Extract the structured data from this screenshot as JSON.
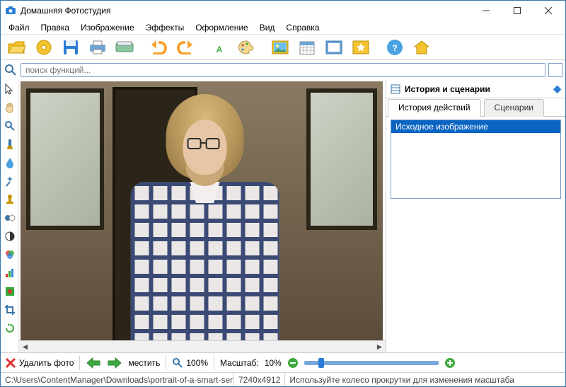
{
  "app_title": "Домашняя Фотостудия",
  "menu": [
    "Файл",
    "Правка",
    "Изображение",
    "Эффекты",
    "Оформление",
    "Вид",
    "Справка"
  ],
  "toolbar_icons": [
    "open",
    "cd",
    "save",
    "print",
    "scan",
    "undo",
    "redo",
    "text",
    "palette",
    "image",
    "calendar",
    "frame",
    "star-frame",
    "help",
    "home"
  ],
  "search_placeholder": "поиск функций...",
  "right": {
    "title": "История и сценарии",
    "tab_history": "История действий",
    "tab_scripts": "Сценарии",
    "history_item": "Исходное изображение"
  },
  "left_tools": [
    "pointer",
    "hand",
    "zoom",
    "brush",
    "drop",
    "wand",
    "stamp",
    "hue",
    "contrast",
    "rgb",
    "levels",
    "redeye",
    "crop",
    "rotate"
  ],
  "bottom": {
    "delete": "Удалить фото",
    "fit_label": "местить",
    "fit_zoom": "100%",
    "scale_label": "Масштаб:",
    "scale_value": "10%"
  },
  "status": {
    "path": "C:\\Users\\ContentManager\\Downloads\\portrait-of-a-smart-serious-young-man-standing-l",
    "dims": "7240x4912",
    "hint": "Используйте колесо прокрутки для изменения масштаба"
  }
}
